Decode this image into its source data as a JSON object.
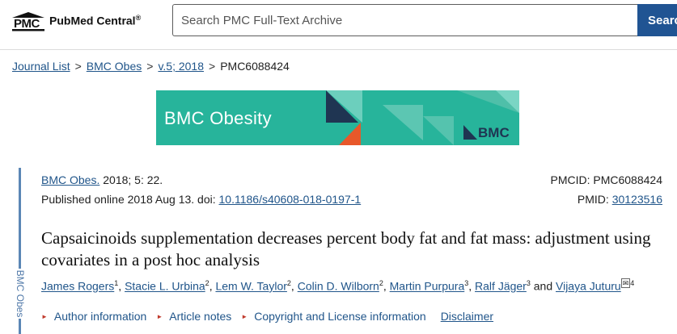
{
  "header": {
    "logo_abbr": "PMC",
    "logo_name": "PubMed Central",
    "logo_reg": "®",
    "search_placeholder": "Search PMC Full-Text Archive",
    "search_button": "Search"
  },
  "breadcrumb": {
    "items": [
      "Journal List",
      "BMC Obes",
      "v.5; 2018"
    ],
    "current": "PMC6088424",
    "separator": ">"
  },
  "banner": {
    "title": "BMC Obesity",
    "brand": "BMC",
    "bg_color": "#27b49b"
  },
  "sidebar": {
    "label": "BMC Obes"
  },
  "article": {
    "journal": "BMC Obes.",
    "citation": " 2018; 5: 22.",
    "published_prefix": "Published online 2018 Aug 13. doi: ",
    "doi": "10.1186/s40608-018-0197-1",
    "pmcid_label": "PMCID: PMC6088424",
    "pmid_label": "PMID: ",
    "pmid": "30123516",
    "title": "Capsaicinoids supplementation decreases percent body fat and fat mass: adjustment using covariates in a post hoc analysis",
    "authors": [
      {
        "name": "James Rogers",
        "sup": "1"
      },
      {
        "name": "Stacie L. Urbina",
        "sup": "2"
      },
      {
        "name": "Lem W. Taylor",
        "sup": "2"
      },
      {
        "name": "Colin D. Wilborn",
        "sup": "2"
      },
      {
        "name": "Martin Purpura",
        "sup": "3"
      },
      {
        "name": "Ralf Jäger",
        "sup": "3"
      },
      {
        "name": "Vijaya Juturu",
        "sup": "4"
      }
    ],
    "and_word": "and",
    "links": [
      "Author information",
      "Article notes",
      "Copyright and License information"
    ],
    "disclaimer": "Disclaimer"
  }
}
